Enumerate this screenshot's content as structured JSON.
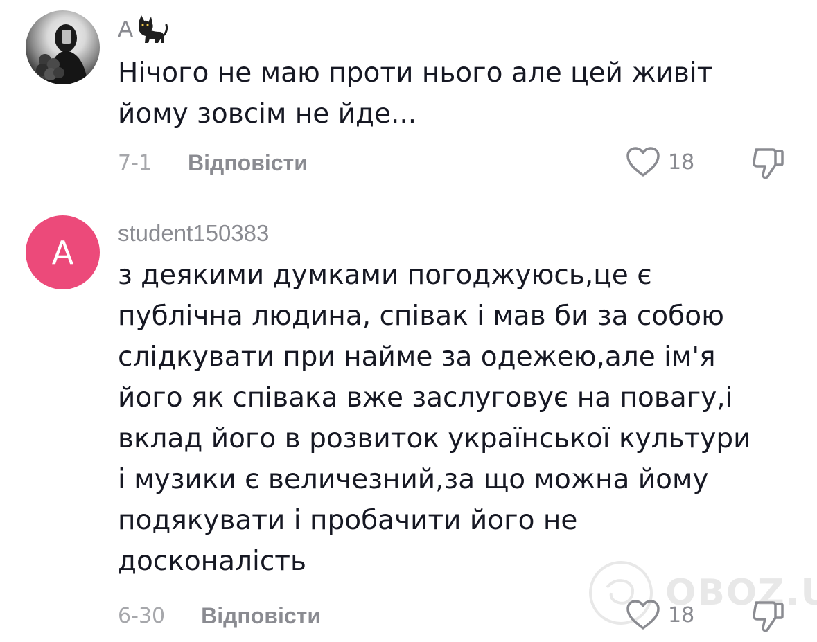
{
  "comments": [
    {
      "username": "A",
      "username_emoji": "cat",
      "text_lines": [
        "Нічого не маю проти нього але цей живіт",
        "йому зовсім не йде..."
      ],
      "date": "7-1",
      "reply_label": "Відповісти",
      "like_count": "18"
    },
    {
      "username": "student150383",
      "avatar_letter": "A",
      "text_lines": [
        "з деякими думками погоджуюсь,це є",
        "публічна людина, співак і мав би за собою",
        "слідкувати при найме за одежею,але ім'я",
        "його як співака вже заслуговує на повагу,і",
        "вклад його в розвиток української культури",
        "і музики є величезний,за що можна йому",
        "подякувати і пробачити його не",
        "досконалість"
      ],
      "date": "6-30",
      "reply_label": "Відповісти",
      "like_count": "18"
    }
  ],
  "watermark": {
    "text": "OBOZ.UA"
  },
  "colors": {
    "text": "#161823",
    "muted": "#8a8b91",
    "avatar_pink": "#ec4a7a"
  },
  "icons": [
    "heart-outline-icon",
    "thumbs-down-icon",
    "cat-emoji-icon"
  ]
}
